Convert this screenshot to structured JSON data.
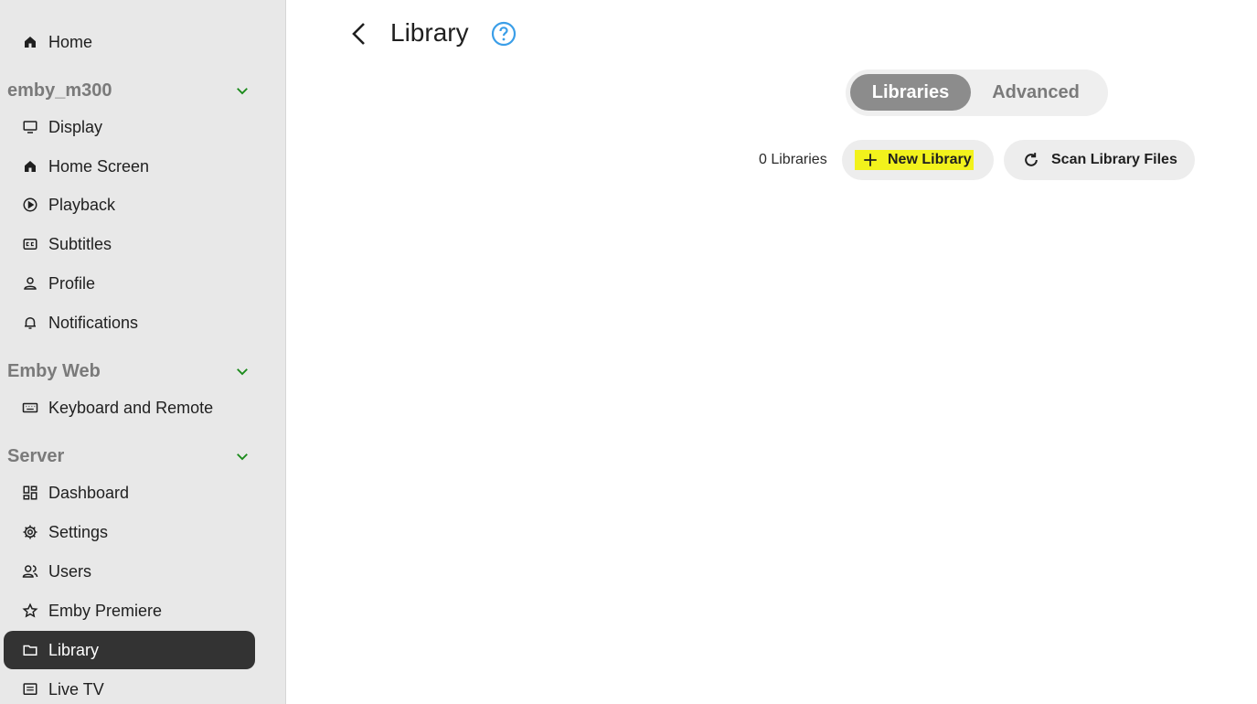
{
  "sidebar": {
    "top_item": {
      "label": "Home",
      "icon": "home-icon"
    },
    "sections": [
      {
        "title": "emby_m300",
        "items": [
          {
            "label": "Display",
            "icon": "monitor-icon"
          },
          {
            "label": "Home Screen",
            "icon": "home-icon"
          },
          {
            "label": "Playback",
            "icon": "play-circle-icon"
          },
          {
            "label": "Subtitles",
            "icon": "closed-captions-icon"
          },
          {
            "label": "Profile",
            "icon": "person-icon"
          },
          {
            "label": "Notifications",
            "icon": "bell-icon"
          }
        ]
      },
      {
        "title": "Emby Web",
        "items": [
          {
            "label": "Keyboard and Remote",
            "icon": "keyboard-icon"
          }
        ]
      },
      {
        "title": "Server",
        "items": [
          {
            "label": "Dashboard",
            "icon": "dashboard-icon"
          },
          {
            "label": "Settings",
            "icon": "gear-icon"
          },
          {
            "label": "Users",
            "icon": "users-icon"
          },
          {
            "label": "Emby Premiere",
            "icon": "star-icon"
          },
          {
            "label": "Library",
            "icon": "folder-icon",
            "active": true
          },
          {
            "label": "Live TV",
            "icon": "tv-guide-icon"
          }
        ]
      }
    ]
  },
  "header": {
    "title": "Library"
  },
  "tabs": [
    {
      "label": "Libraries",
      "active": true
    },
    {
      "label": "Advanced",
      "active": false
    }
  ],
  "toolbar": {
    "library_count": "0 Libraries",
    "new_library_label": "New Library",
    "scan_label": "Scan Library Files"
  },
  "colors": {
    "sidebar_bg": "#e8e8e8",
    "active_item_bg": "#333333",
    "chevron": "#1a8a1a",
    "help_icon": "#3a9ee8",
    "highlight": "#f2f21c",
    "active_tab_bg": "#8c8c8c"
  }
}
